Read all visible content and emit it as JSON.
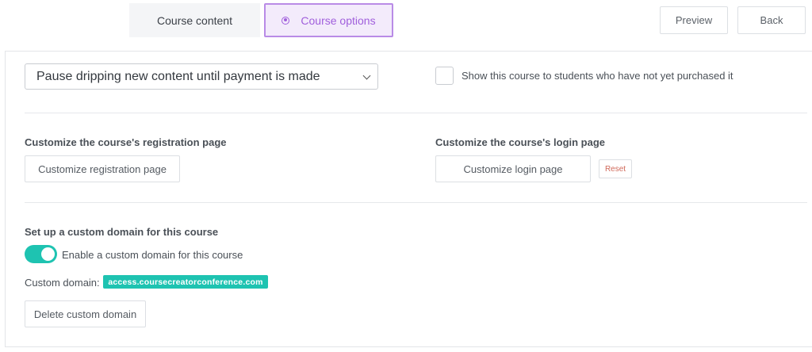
{
  "tabs": {
    "content_label": "Course content",
    "options_label": "Course options"
  },
  "header_buttons": {
    "preview_label": "Preview",
    "back_label": "Back"
  },
  "drip": {
    "selected": "Pause dripping new content until payment is made"
  },
  "visibility": {
    "checkbox_label": "Show this course to students who have not yet purchased it",
    "checked": false
  },
  "registration": {
    "title": "Customize the course's registration page",
    "button_label": "Customize registration page"
  },
  "login": {
    "title": "Customize the course's login page",
    "button_label": "Customize login page",
    "reset_label": "Reset"
  },
  "custom_domain": {
    "title": "Set up a custom domain for this course",
    "toggle_label": "Enable a custom domain for this course",
    "toggle_on": true,
    "domain_label": "Custom domain:",
    "domain_value": "access.coursecreatorconference.com",
    "delete_label": "Delete custom domain"
  },
  "colors": {
    "accent_purple": "#a05fdc",
    "accent_teal": "#1ec3b1",
    "reset_red": "#d0695a"
  }
}
